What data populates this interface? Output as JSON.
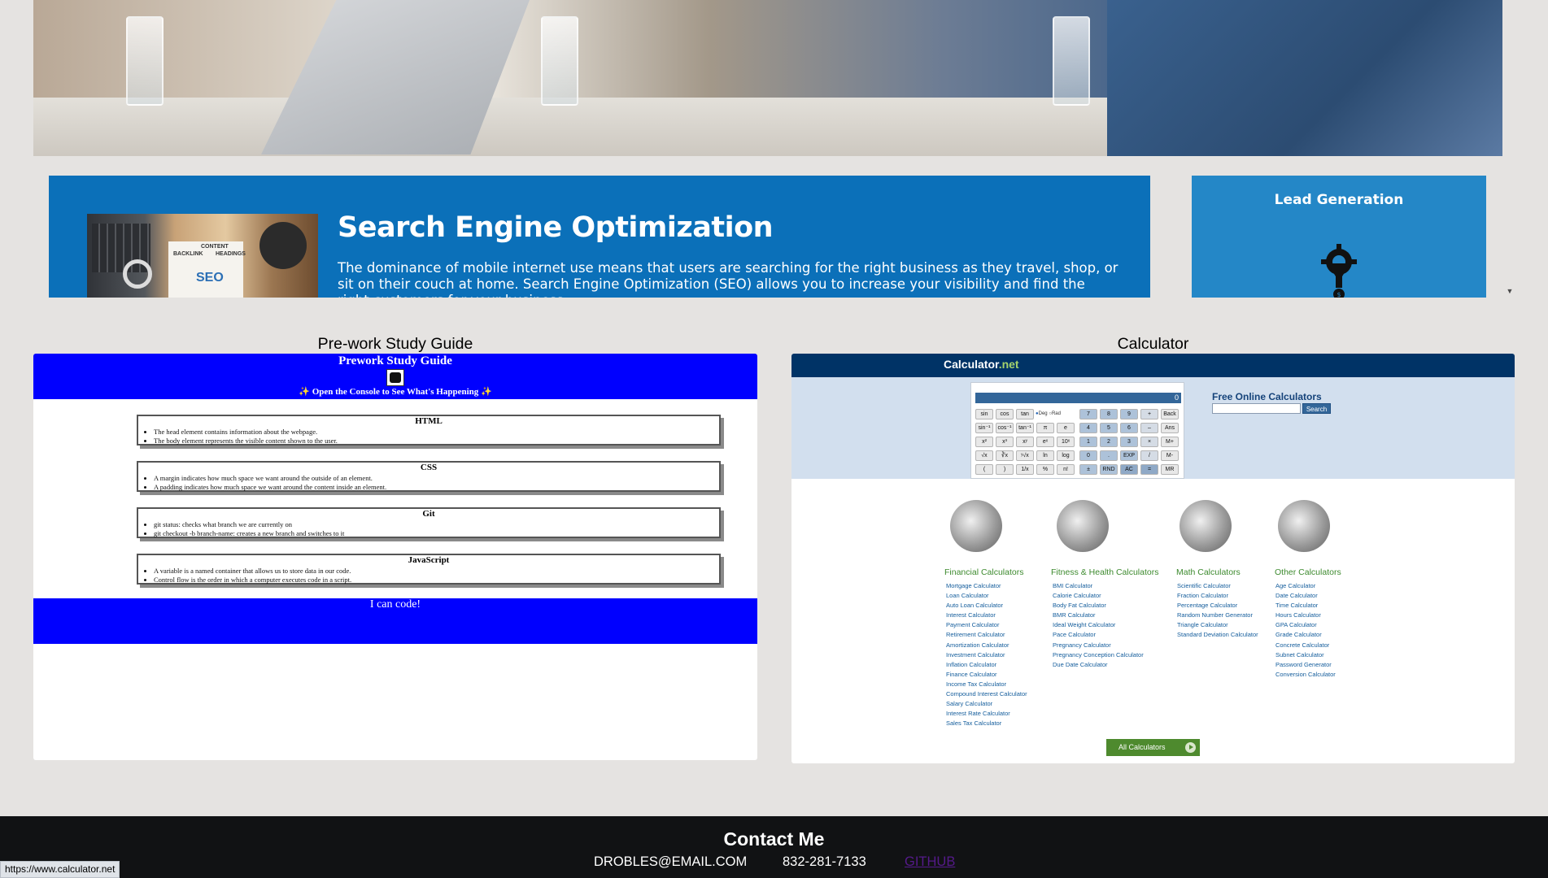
{
  "seo": {
    "title": "Search Engine Optimization",
    "body": "The dominance of mobile internet use means that users are searching for the right business as they travel, shop, or sit on their couch at home. Search Engine Optimization (SEO) allows you to increase your visibility and find the right customers for your business.",
    "image_words": [
      "BACKLINK",
      "CONTENT",
      "HEADINGS",
      "SEO"
    ]
  },
  "lead": {
    "title": "Lead Generation"
  },
  "scroll_arrow": "▼",
  "sections": {
    "prework_heading": "Pre-work Study Guide",
    "calculator_heading": "Calculator"
  },
  "prework": {
    "title": "Prework Study Guide",
    "console_note": "Open the Console to See What's Happening",
    "spark": "✨",
    "topics": [
      {
        "title": "HTML",
        "points": [
          "The head element contains information about the webpage.",
          "The body element represents the visible content shown to the user."
        ]
      },
      {
        "title": "CSS",
        "points": [
          "A margin indicates how much space we want around the outside of an element.",
          "A padding indicates how much space we want around the content inside an element."
        ]
      },
      {
        "title": "Git",
        "points": [
          "git status: checks what branch we are currently on",
          "git checkout -b branch-name: creates a new branch and switches to it"
        ]
      },
      {
        "title": "JavaScript",
        "points": [
          "A variable is a named container that allows us to store data in our code.",
          "Control flow is the order in which a computer executes code in a script."
        ]
      }
    ],
    "footer": "I can code!"
  },
  "calculator": {
    "brand_main": "Calculator",
    "brand_net": ".net",
    "display": "0",
    "deg_label": "Deg",
    "rad_label": "Rad",
    "keys": [
      [
        "sin",
        "cos",
        "tan",
        "",
        "",
        "7",
        "8",
        "9",
        "+",
        "Back"
      ],
      [
        "sin⁻¹",
        "cos⁻¹",
        "tan⁻¹",
        "π",
        "e",
        "4",
        "5",
        "6",
        "–",
        "Ans"
      ],
      [
        "x²",
        "x³",
        "xʸ",
        "eˣ",
        "10ˣ",
        "1",
        "2",
        "3",
        "×",
        "M+"
      ],
      [
        "√x",
        "∛x",
        "ʸ√x",
        "ln",
        "log",
        "0",
        ".",
        "EXP",
        "/",
        "M-"
      ],
      [
        "(",
        ")",
        "1/x",
        "%",
        "n!",
        "±",
        "RND",
        "AC",
        "=",
        "MR"
      ]
    ],
    "free_title": "Free Online Calculators",
    "search_button": "Search",
    "categories": [
      {
        "title": "Financial Calculators",
        "links": [
          "Mortgage Calculator",
          "Loan Calculator",
          "Auto Loan Calculator",
          "Interest Calculator",
          "Payment Calculator",
          "Retirement Calculator",
          "Amortization Calculator",
          "Investment Calculator",
          "Inflation Calculator",
          "Finance Calculator",
          "Income Tax Calculator",
          "Compound Interest Calculator",
          "Salary Calculator",
          "Interest Rate Calculator",
          "Sales Tax Calculator"
        ]
      },
      {
        "title": "Fitness & Health Calculators",
        "links": [
          "BMI Calculator",
          "Calorie Calculator",
          "Body Fat Calculator",
          "BMR Calculator",
          "Ideal Weight Calculator",
          "Pace Calculator",
          "Pregnancy Calculator",
          "Pregnancy Conception Calculator",
          "Due Date Calculator"
        ]
      },
      {
        "title": "Math Calculators",
        "links": [
          "Scientific Calculator",
          "Fraction Calculator",
          "Percentage Calculator",
          "Random Number Generator",
          "Triangle Calculator",
          "Standard Deviation Calculator"
        ]
      },
      {
        "title": "Other Calculators",
        "links": [
          "Age Calculator",
          "Date Calculator",
          "Time Calculator",
          "Hours Calculator",
          "GPA Calculator",
          "Grade Calculator",
          "Concrete Calculator",
          "Subnet Calculator",
          "Password Generator",
          "Conversion Calculator"
        ]
      }
    ],
    "all_button": "All Calculators"
  },
  "footer": {
    "title": "Contact Me",
    "email": "DROBLES@EMAIL.COM",
    "phone": "832-281-7133",
    "github": "GITHUB"
  },
  "status_url": "https://www.calculator.net",
  "colors": {
    "seo_panel": "#0b70b9",
    "lead_panel": "#2487c7",
    "prework_blue": "#0000ff",
    "calc_navy": "#003366",
    "footer_bg": "#111214"
  }
}
